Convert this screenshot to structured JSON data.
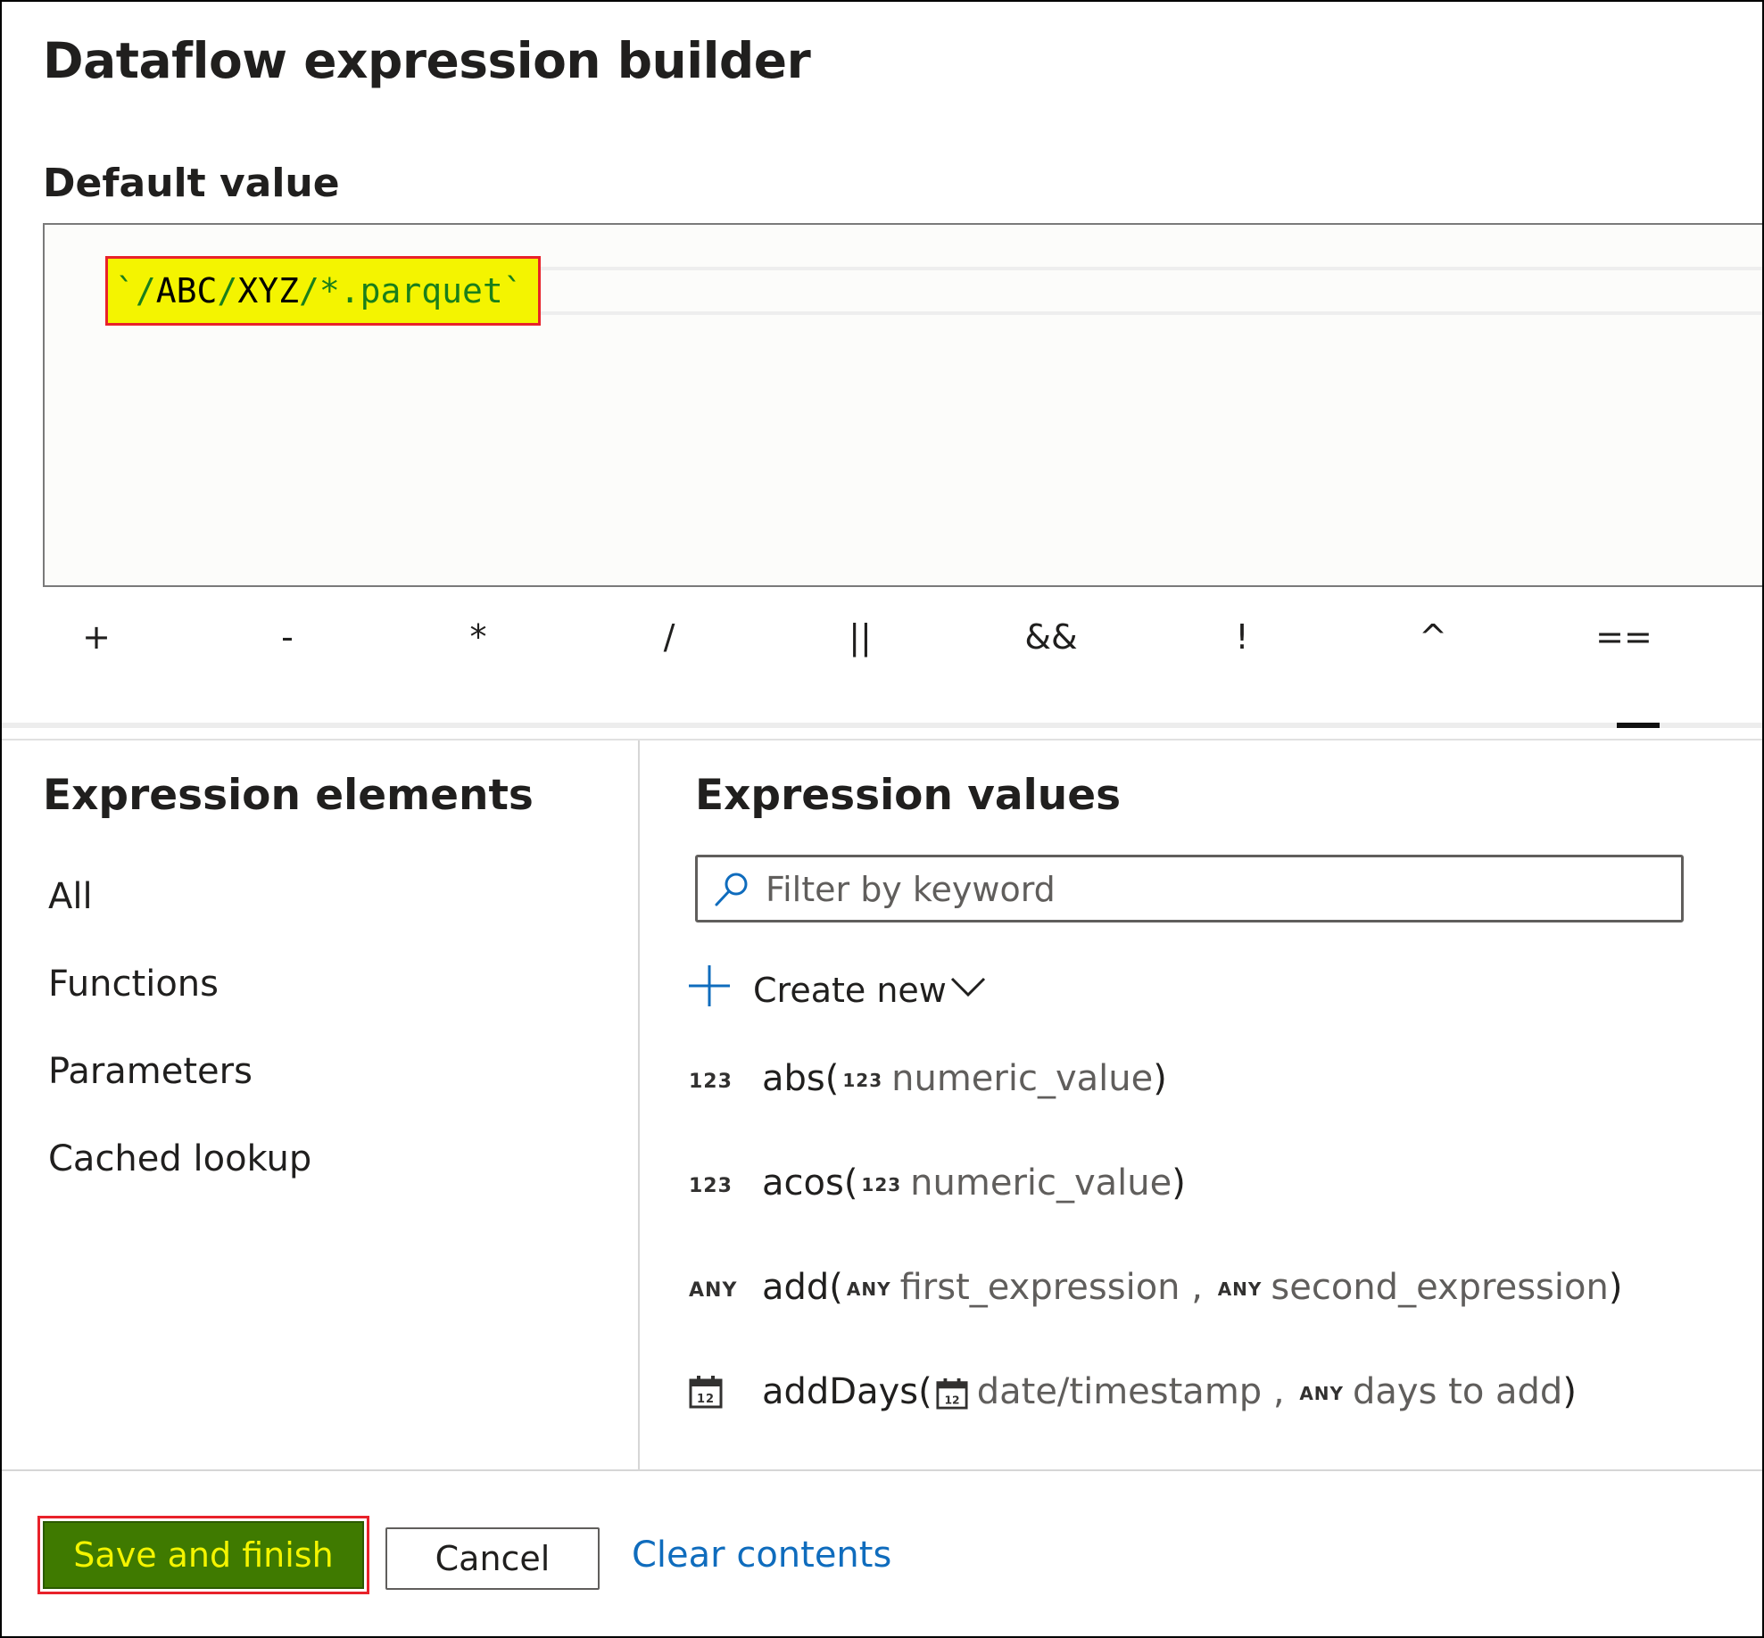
{
  "dialog": {
    "title": "Dataflow expression builder",
    "section_label": "Default value"
  },
  "editor": {
    "code_open_tick": "`",
    "code_path_parts": [
      "/",
      "ABC",
      "/",
      "XYZ",
      "/*.parquet"
    ],
    "code_close_tick": "`"
  },
  "operators": [
    "+",
    "-",
    "*",
    "/",
    "||",
    "&&",
    "!",
    "^",
    "=="
  ],
  "elements_panel": {
    "title": "Expression elements",
    "items": [
      "All",
      "Functions",
      "Parameters",
      "Cached lookup"
    ]
  },
  "values_panel": {
    "title": "Expression values",
    "search_placeholder": "Filter by keyword",
    "create_new_label": "Create new",
    "functions": [
      {
        "return_type": "123",
        "name": "abs(",
        "arg1_type": "123",
        "arg1": "numeric_value",
        "close": ")"
      },
      {
        "return_type": "123",
        "name": "acos(",
        "arg1_type": "123",
        "arg1": "numeric_value",
        "close": ")"
      },
      {
        "return_type": "ANY",
        "name": "add(",
        "arg1_type": "ANY",
        "arg1": "first_expression",
        "sep": " , ",
        "arg2_type": "ANY",
        "arg2": "second_expression",
        "close": ")"
      },
      {
        "return_type_icon": "calendar-icon",
        "name": "addDays(",
        "arg1_type_icon": "calendar-icon",
        "arg1": "date/timestamp",
        "sep": " , ",
        "arg2_type": "ANY",
        "arg2": "days to add",
        "close": ")"
      }
    ]
  },
  "footer": {
    "save_label": "Save and finish",
    "cancel_label": "Cancel",
    "clear_label": "Clear contents"
  },
  "colors": {
    "save_bg": "#3f7a00",
    "highlight": "#f4f400",
    "highlight_border": "#e8222a",
    "link": "#0f6cbd",
    "code_green": "#1a7f1a"
  }
}
